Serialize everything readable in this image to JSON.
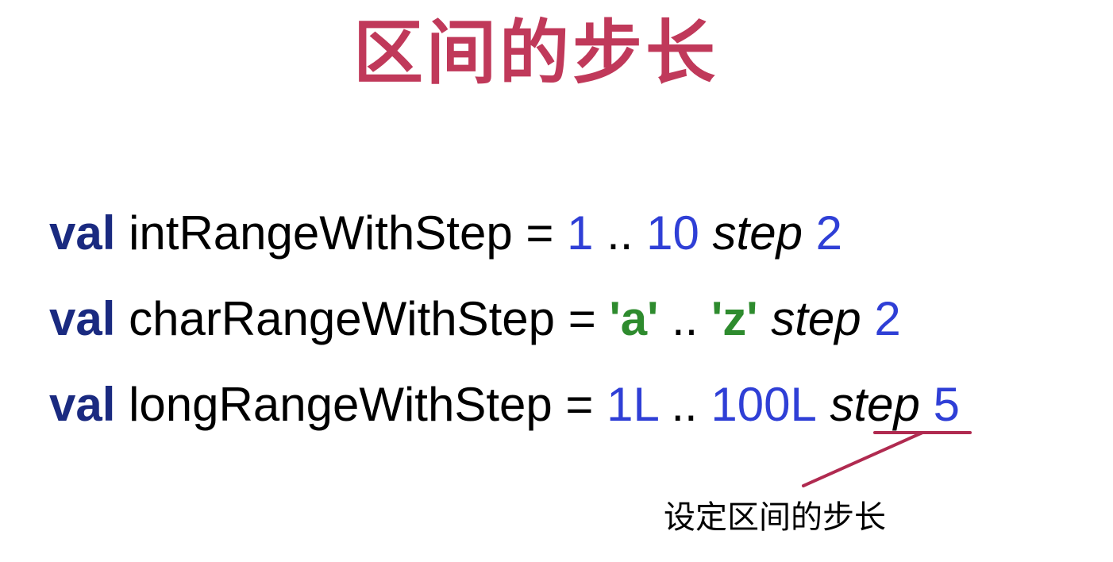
{
  "slide": {
    "title": "区间的步长",
    "note": "设定区间的步长"
  },
  "code": {
    "lines": [
      {
        "keyword": "val",
        "name": " intRangeWithStep = ",
        "start": "1",
        "range_op": " .. ",
        "end": "10",
        "infix": " step",
        "step": " 2"
      },
      {
        "keyword": "val",
        "name": " charRangeWithStep = ",
        "start": "'a'",
        "range_op": " .. ",
        "end": "'z'",
        "infix": " step",
        "step": " 2"
      },
      {
        "keyword": "val",
        "name": " longRangeWithStep = ",
        "start": "1L",
        "range_op": " .. ",
        "end": "100L",
        "infix": " step",
        "step": " 5"
      }
    ]
  },
  "colors": {
    "title": "#c0395a",
    "keyword": "#1a2a80",
    "number_literal": "#2f3fd6",
    "char_literal": "#2e8b2e",
    "plain_text": "#000000",
    "annotation_line": "#b02a50"
  }
}
